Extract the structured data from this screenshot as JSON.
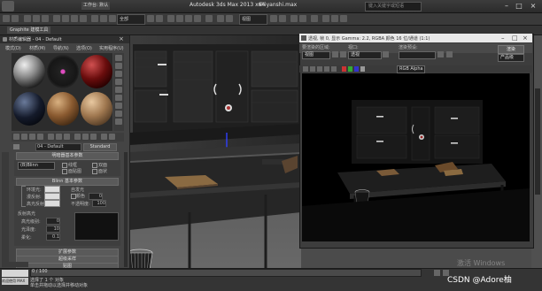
{
  "window": {
    "app_title": "Autodesk 3ds Max 2013 x64",
    "file_title": "shiyanshi.max",
    "workspace": "工作台: 默认",
    "search_placeholder": "键入关键字或短语"
  },
  "toolbar": {
    "selection_filter": "全部",
    "named_selection": "视图"
  },
  "ribbon": {
    "tab_label": "Graphite 建模工具"
  },
  "material_editor": {
    "title": "材质编辑器 - 04 - Default",
    "menu": [
      "模式(D)",
      "材质(M)",
      "导航(N)",
      "选项(O)",
      "实用程序(U)"
    ],
    "material_name": "04 - Default",
    "material_type": "Standard",
    "shader": {
      "header": "明暗器基本参数",
      "shader_type": "(B)Blinn",
      "options": [
        "线框",
        "双面",
        "面贴图",
        "面状"
      ]
    },
    "basic": {
      "header": "Blinn 基本参数",
      "self_illum_group": "自发光",
      "color_label": "颜色",
      "color_value": "0",
      "labels": [
        "环境光:",
        "漫反射:",
        "高光反射:"
      ],
      "opacity_label": "不透明度:",
      "opacity_value": "100"
    },
    "specular": {
      "header": "反射高光",
      "labels": [
        "高光级别:",
        "光泽度:",
        "柔化:"
      ],
      "values": [
        "0",
        "10",
        "0.1"
      ]
    },
    "rollouts": [
      "扩展参数",
      "超级采样",
      "贴图"
    ]
  },
  "render_frame": {
    "title": "透视, 帧 0, 显示 Gamma: 2.2, RGBA 颜色 16 位/通道 (1:1)",
    "area_label": "要渲染的区域:",
    "area_value": "视图",
    "viewport_label": "视口:",
    "viewport_value": "透视",
    "preset_label": "渲染预设:",
    "preset_value": "",
    "render_button": "渲染",
    "quality": "产品级",
    "channel": "RGB Alpha"
  },
  "status": {
    "selection": "选择了 1 个 对象",
    "prompt": "单击并拖动以选择并移动对象",
    "frame": "0 / 100",
    "maxscript": "欢迎使用 MAX",
    "activate": "激活 Windows",
    "watermark": "CSDN @Adore柚"
  },
  "colors": {
    "viewport_bg": "#4c4c4c",
    "panel_bg": "#444444",
    "render_bg": "#000000"
  }
}
